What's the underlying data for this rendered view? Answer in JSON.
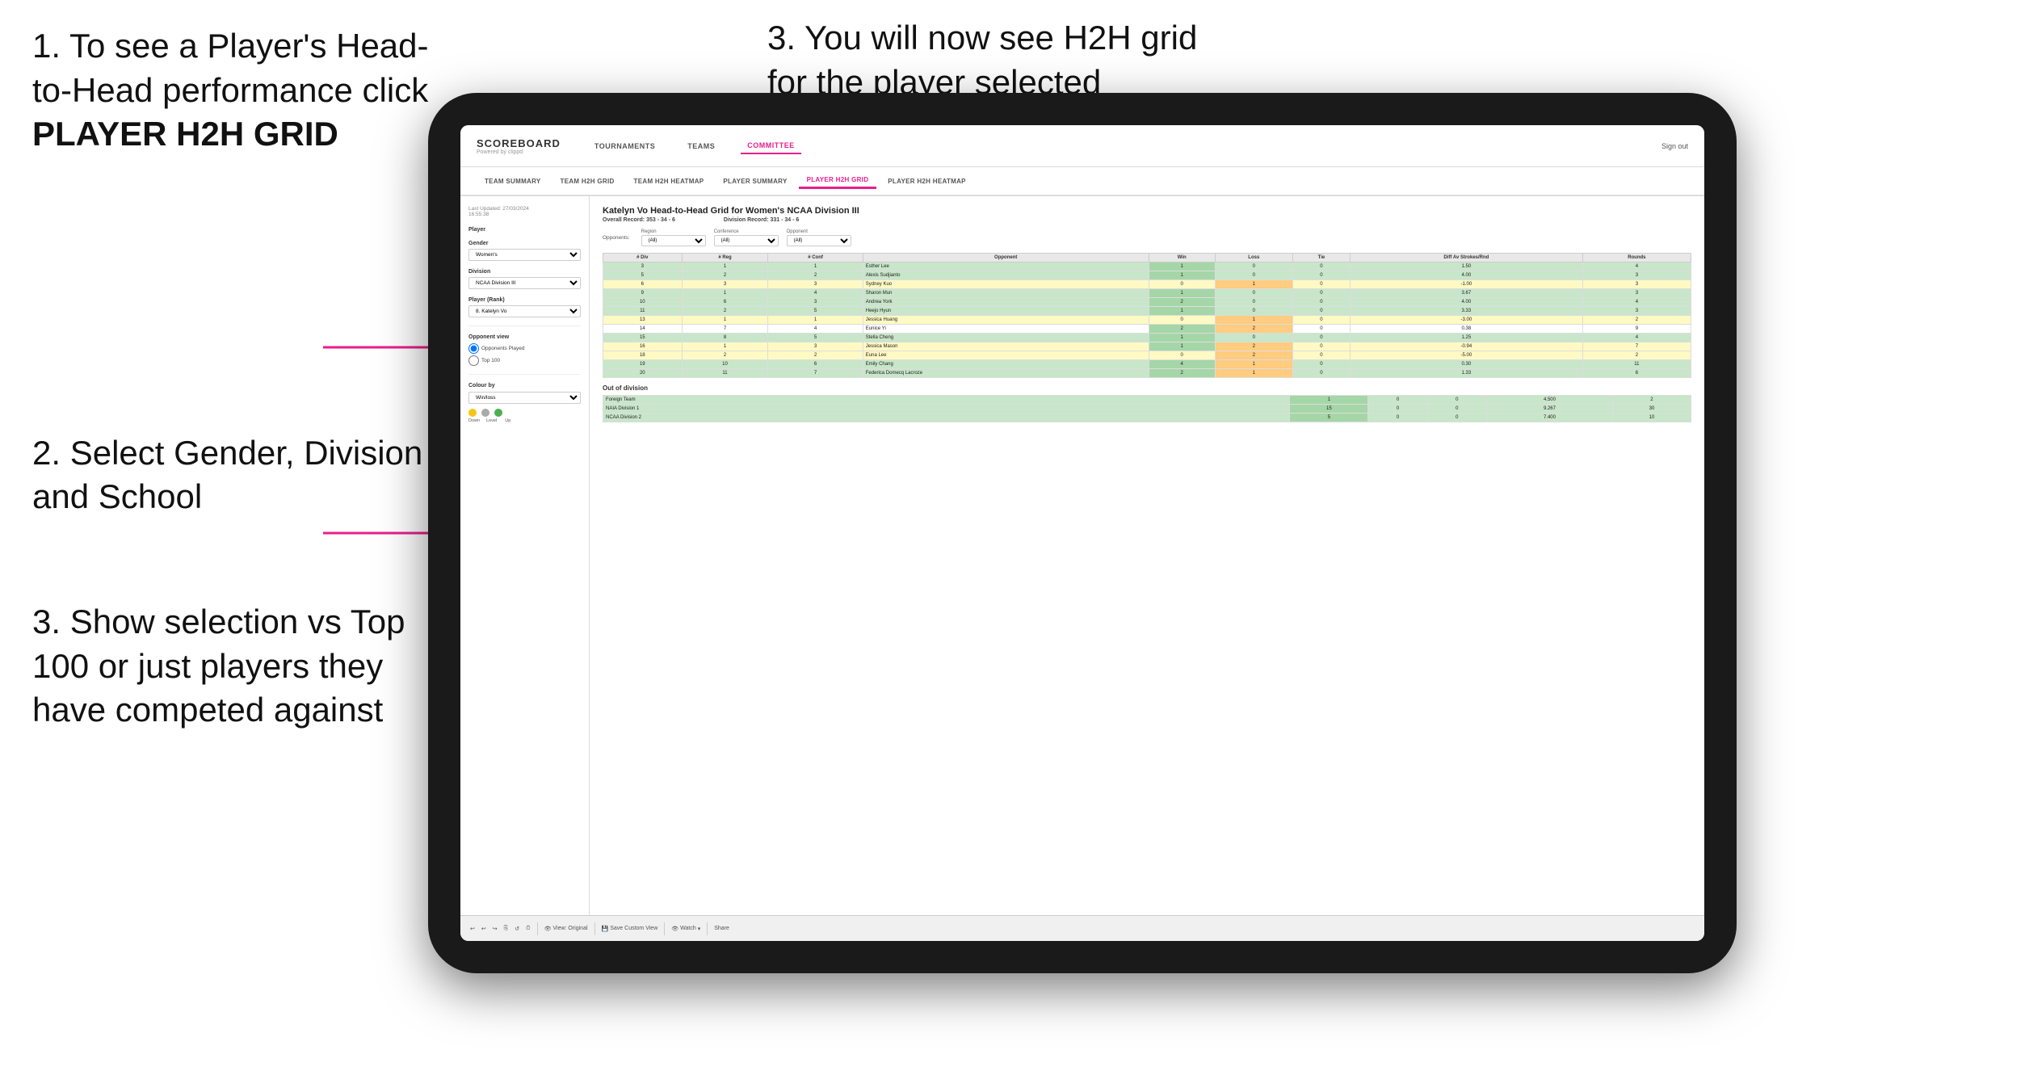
{
  "page": {
    "instructions": [
      {
        "id": "inst1",
        "text": "1. To see a Player's Head-to-Head performance click",
        "bold": "PLAYER H2H GRID"
      },
      {
        "id": "inst2",
        "text": "2. Select Gender, Division and School"
      },
      {
        "id": "inst3",
        "text": "3. Show selection vs Top 100 or just players they have competed against"
      }
    ],
    "instruction_right": "3. You will now see H2H grid for the player selected",
    "navbar": {
      "logo": "SCOREBOARD",
      "logo_sub": "Powered by clippd",
      "items": [
        "TOURNAMENTS",
        "TEAMS",
        "COMMITTEE"
      ],
      "active_item": "COMMITTEE",
      "sign_out": "Sign out"
    },
    "subnav": {
      "items": [
        "TEAM SUMMARY",
        "TEAM H2H GRID",
        "TEAM H2H HEATMAP",
        "PLAYER SUMMARY",
        "PLAYER H2H GRID",
        "PLAYER H2H HEATMAP"
      ],
      "active_item": "PLAYER H2H GRID"
    },
    "sidebar": {
      "last_updated_label": "Last Updated: 27/03/2024",
      "last_updated_time": "16:55:38",
      "player_label": "Player",
      "gender_label": "Gender",
      "gender_value": "Women's",
      "division_label": "Division",
      "division_value": "NCAA Division III",
      "player_rank_label": "Player (Rank)",
      "player_rank_value": "8. Katelyn Vo",
      "opponent_view_title": "Opponent view",
      "radio_options": [
        "Opponents Played",
        "Top 100"
      ],
      "radio_selected": "Opponents Played",
      "colour_by_label": "Colour by",
      "colour_by_value": "Win/loss",
      "colour_legend": [
        {
          "color": "yellow",
          "label": "Down"
        },
        {
          "color": "gray",
          "label": "Level"
        },
        {
          "color": "green",
          "label": "Up"
        }
      ]
    },
    "main": {
      "title": "Katelyn Vo Head-to-Head Grid for Women's NCAA Division III",
      "overall_record_label": "Overall Record:",
      "overall_record_value": "353 - 34 - 6",
      "division_record_label": "Division Record:",
      "division_record_value": "331 - 34 - 6",
      "filters": {
        "opponents_label": "Opponents:",
        "region_label": "Region",
        "region_value": "(All)",
        "conference_label": "Conference",
        "conference_value": "(All)",
        "opponent_label": "Opponent",
        "opponent_value": "(All)"
      },
      "table_headers": [
        "# Div",
        "# Reg",
        "# Conf",
        "Opponent",
        "Win",
        "Loss",
        "Tie",
        "Diff Av Strokes/Rnd",
        "Rounds"
      ],
      "rows": [
        {
          "div": 3,
          "reg": 1,
          "conf": 1,
          "opponent": "Esther Lee",
          "win": 1,
          "loss": 0,
          "tie": 0,
          "diff": 1.5,
          "rounds": 4,
          "color": "green"
        },
        {
          "div": 5,
          "reg": 2,
          "conf": 2,
          "opponent": "Alexis Sudjianto",
          "win": 1,
          "loss": 0,
          "tie": 0,
          "diff": 4.0,
          "rounds": 3,
          "color": "green"
        },
        {
          "div": 6,
          "reg": 3,
          "conf": 3,
          "opponent": "Sydney Kuo",
          "win": 0,
          "loss": 1,
          "tie": 0,
          "diff": -1.0,
          "rounds": 3,
          "color": "yellow"
        },
        {
          "div": 9,
          "reg": 1,
          "conf": 4,
          "opponent": "Sharon Mun",
          "win": 1,
          "loss": 0,
          "tie": 0,
          "diff": 3.67,
          "rounds": 3,
          "color": "green"
        },
        {
          "div": 10,
          "reg": 6,
          "conf": 3,
          "opponent": "Andrea York",
          "win": 2,
          "loss": 0,
          "tie": 0,
          "diff": 4.0,
          "rounds": 4,
          "color": "green"
        },
        {
          "div": 11,
          "reg": 2,
          "conf": 5,
          "opponent": "Heejo Hyun",
          "win": 1,
          "loss": 0,
          "tie": 0,
          "diff": 3.33,
          "rounds": 3,
          "color": "green"
        },
        {
          "div": 13,
          "reg": 1,
          "conf": 1,
          "opponent": "Jessica Huang",
          "win": 0,
          "loss": 1,
          "tie": 0,
          "diff": -3.0,
          "rounds": 2,
          "color": "yellow"
        },
        {
          "div": 14,
          "reg": 7,
          "conf": 4,
          "opponent": "Eunice Yi",
          "win": 2,
          "loss": 2,
          "tie": 0,
          "diff": 0.38,
          "rounds": 9,
          "color": "white"
        },
        {
          "div": 15,
          "reg": 8,
          "conf": 5,
          "opponent": "Stella Cheng",
          "win": 1,
          "loss": 0,
          "tie": 0,
          "diff": 1.25,
          "rounds": 4,
          "color": "green"
        },
        {
          "div": 16,
          "reg": 1,
          "conf": 3,
          "opponent": "Jessica Mason",
          "win": 1,
          "loss": 2,
          "tie": 0,
          "diff": -0.94,
          "rounds": 7,
          "color": "yellow"
        },
        {
          "div": 18,
          "reg": 2,
          "conf": 2,
          "opponent": "Euna Lee",
          "win": 0,
          "loss": 2,
          "tie": 0,
          "diff": -5.0,
          "rounds": 2,
          "color": "yellow"
        },
        {
          "div": 19,
          "reg": 10,
          "conf": 6,
          "opponent": "Emily Chang",
          "win": 4,
          "loss": 1,
          "tie": 0,
          "diff": 0.3,
          "rounds": 11,
          "color": "green"
        },
        {
          "div": 20,
          "reg": 11,
          "conf": 7,
          "opponent": "Federica Domecq Lacroze",
          "win": 2,
          "loss": 1,
          "tie": 0,
          "diff": 1.33,
          "rounds": 6,
          "color": "green"
        }
      ],
      "out_of_division_title": "Out of division",
      "out_of_division_rows": [
        {
          "label": "Foreign Team",
          "win": 1,
          "loss": 0,
          "tie": 0,
          "diff": 4.5,
          "rounds": 2,
          "color": "green"
        },
        {
          "label": "NAIA Division 1",
          "win": 15,
          "loss": 0,
          "tie": 0,
          "diff": 9.267,
          "rounds": 30,
          "color": "green"
        },
        {
          "label": "NCAA Division 2",
          "win": 5,
          "loss": 0,
          "tie": 0,
          "diff": 7.4,
          "rounds": 10,
          "color": "green"
        }
      ],
      "toolbar": {
        "view_original": "View: Original",
        "save_custom_view": "Save Custom View",
        "watch": "Watch",
        "share": "Share"
      }
    }
  }
}
